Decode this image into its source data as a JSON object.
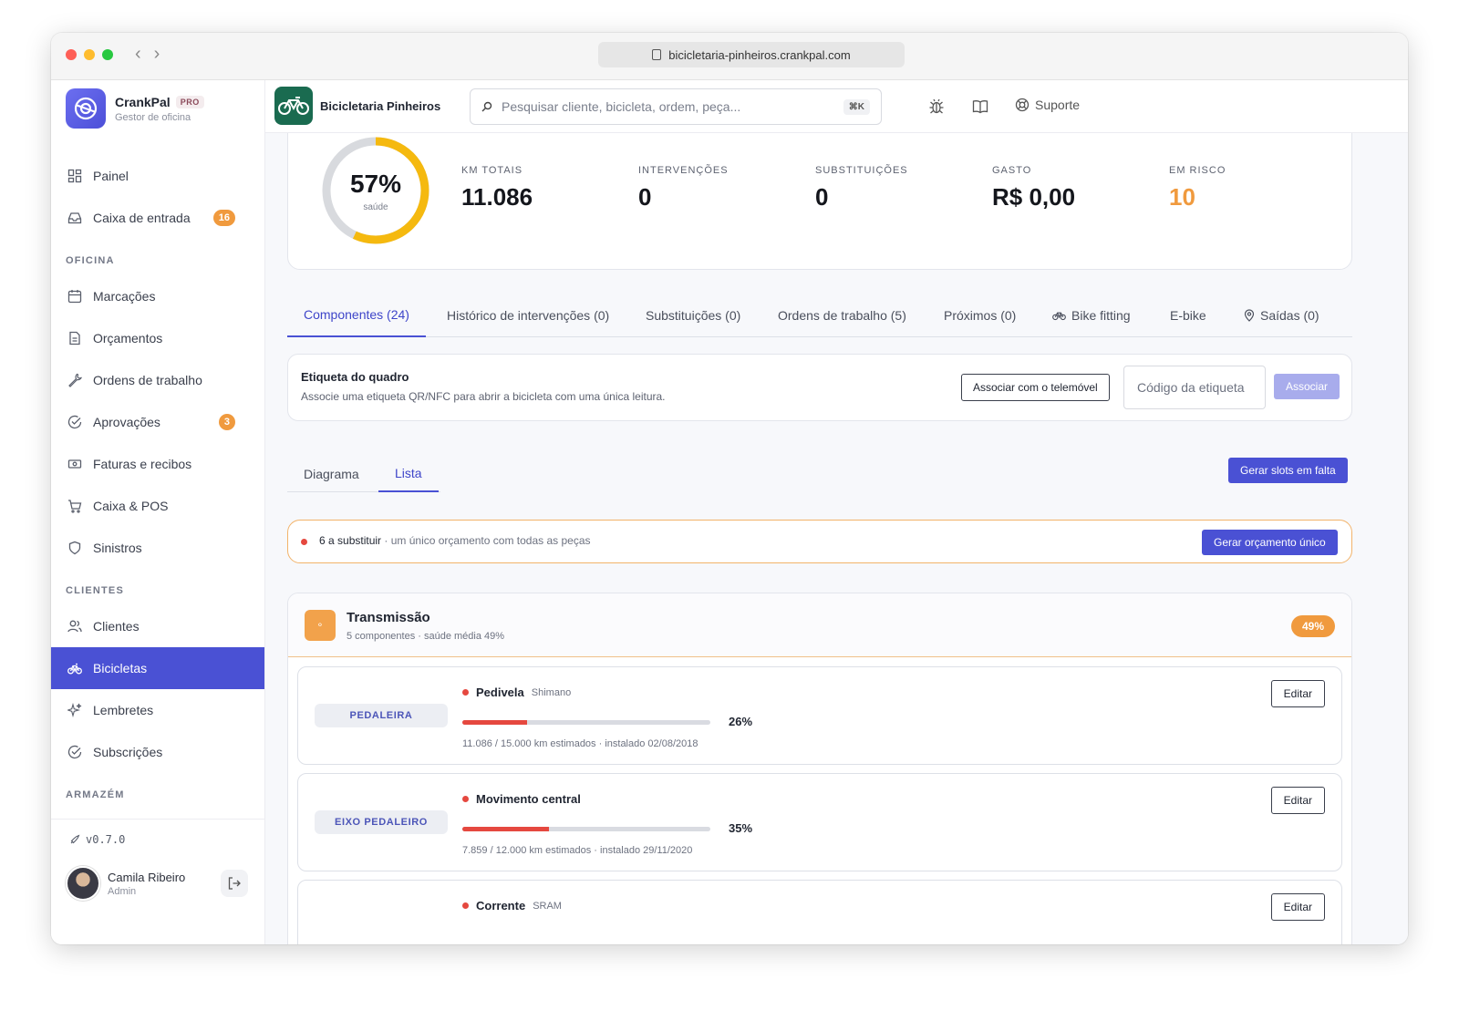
{
  "browser": {
    "url": "bicicletaria-pinheiros.crankpal.com"
  },
  "brand": {
    "name": "CrankPal",
    "badge": "PRO",
    "subtitle": "Gestor de oficina"
  },
  "sidebar": {
    "top_items": [
      {
        "label": "Painel",
        "icon": "grid-icon"
      },
      {
        "label": "Caixa de entrada",
        "icon": "inbox-icon",
        "count": "16"
      }
    ],
    "sections": [
      {
        "title": "OFICINA",
        "items": [
          {
            "label": "Marcações",
            "icon": "calendar-icon"
          },
          {
            "label": "Orçamentos",
            "icon": "document-icon"
          },
          {
            "label": "Ordens de trabalho",
            "icon": "wrench-icon"
          },
          {
            "label": "Aprovações",
            "icon": "check-circle-icon",
            "count": "3"
          },
          {
            "label": "Faturas e recibos",
            "icon": "banknote-icon"
          },
          {
            "label": "Caixa & POS",
            "icon": "cart-icon"
          },
          {
            "label": "Sinistros",
            "icon": "shield-icon"
          }
        ]
      },
      {
        "title": "CLIENTES",
        "items": [
          {
            "label": "Clientes",
            "icon": "users-icon"
          },
          {
            "label": "Bicicletas",
            "icon": "bike-icon",
            "active": true
          },
          {
            "label": "Lembretes",
            "icon": "sparkle-icon"
          },
          {
            "label": "Subscrições",
            "icon": "check-circle-icon"
          }
        ]
      },
      {
        "title": "ARMAZÉM",
        "items": []
      }
    ],
    "version": "v0.7.0",
    "user": {
      "name": "Camila Ribeiro",
      "role": "Admin"
    }
  },
  "topbar": {
    "shop_name": "Bicicletaria Pinheiros",
    "search_placeholder": "Pesquisar cliente, bicicleta, ordem, peça...",
    "search_shortcut": "⌘K",
    "support_label": "Suporte"
  },
  "stats": {
    "health_percent": 57,
    "health_value": "57%",
    "health_label": "saúde",
    "items": [
      {
        "label": "KM TOTAIS",
        "value": "11.086"
      },
      {
        "label": "INTERVENÇÕES",
        "value": "0"
      },
      {
        "label": "SUBSTITUIÇÕES",
        "value": "0"
      },
      {
        "label": "GASTO",
        "value": "R$ 0,00"
      },
      {
        "label": "EM RISCO",
        "value": "10",
        "color": "#f09a3e"
      }
    ]
  },
  "tabs": [
    {
      "label": "Componentes (24)",
      "active": true
    },
    {
      "label": "Histórico de intervenções (0)"
    },
    {
      "label": "Substituições (0)"
    },
    {
      "label": "Ordens de trabalho (5)"
    },
    {
      "label": "Próximos (0)"
    },
    {
      "label": "Bike fitting",
      "icon": "bike-icon"
    },
    {
      "label": "E-bike"
    },
    {
      "label": "Saídas (0)",
      "icon": "pin-icon"
    }
  ],
  "frame_tag": {
    "title": "Etiqueta do quadro",
    "description": "Associe uma etiqueta QR/NFC para abrir a bicicleta com uma única leitura.",
    "phone_button": "Associar com o telemóvel",
    "code_placeholder": "Código da etiqueta",
    "associate_button": "Associar"
  },
  "view": {
    "tabs": [
      {
        "label": "Diagrama"
      },
      {
        "label": "Lista",
        "active": true
      }
    ],
    "generate_slots_button": "Gerar slots em falta"
  },
  "alert": {
    "count_text": "6 a substituir",
    "detail_text": " · um único orçamento com todas as peças",
    "button": "Gerar orçamento único"
  },
  "group": {
    "title": "Transmissão",
    "subtitle": "5 componentes · saúde média 49%",
    "badge": "49%",
    "components": [
      {
        "position": "PEDALEIRA",
        "name": "Pedivela",
        "brand": "Shimano",
        "health": 26,
        "health_label": "26%",
        "meta": "11.086 / 15.000 km estimados · instalado 02/08/2018",
        "edit": "Editar"
      },
      {
        "position": "EIXO PEDALEIRO",
        "name": "Movimento central",
        "brand": "",
        "health": 35,
        "health_label": "35%",
        "meta": "7.859 / 12.000 km estimados · instalado 29/11/2020",
        "edit": "Editar"
      },
      {
        "position": "",
        "name": "Corrente",
        "brand": "SRAM",
        "health": null,
        "health_label": "",
        "meta": "",
        "edit": "Editar"
      }
    ]
  },
  "colors": {
    "accent": "#4a51d4",
    "warning": "#f09a3e",
    "danger": "#e5483f",
    "gauge": "#f5b90f"
  }
}
